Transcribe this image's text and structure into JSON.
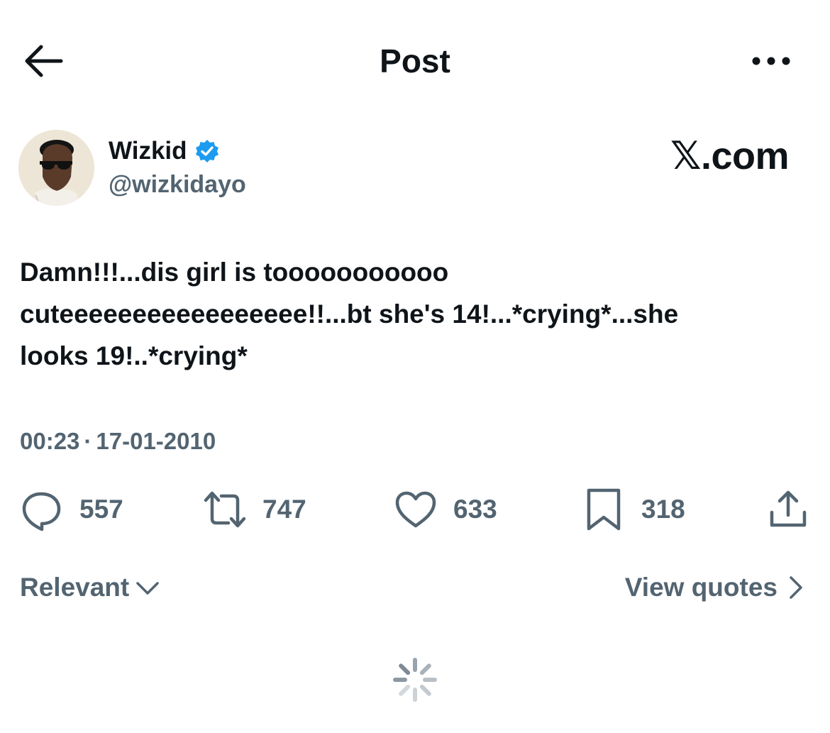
{
  "header": {
    "title": "Post",
    "back_icon": "arrow-left-icon",
    "more_icon": "more-horizontal-icon"
  },
  "author": {
    "name": "Wizkid",
    "handle": "@wizkidayo",
    "verified": true,
    "verified_color": "#1d9bf0"
  },
  "brand": {
    "label": "𝕏.com"
  },
  "tweet": {
    "text": "Damn!!!...dis girl is tooooooooooo\ncuteeeeeeeeeeeeeeeee!!...bt she's 14!...*crying*...she\nlooks 19!..*crying*",
    "time": "00:23",
    "separator": "·",
    "date": "17-01-2010"
  },
  "actions": {
    "reply_count": "557",
    "repost_count": "747",
    "like_count": "633",
    "bookmark_count": "318",
    "icon_color": "#536471"
  },
  "footer": {
    "sort_label": "Relevant",
    "quotes_label": "View quotes"
  }
}
